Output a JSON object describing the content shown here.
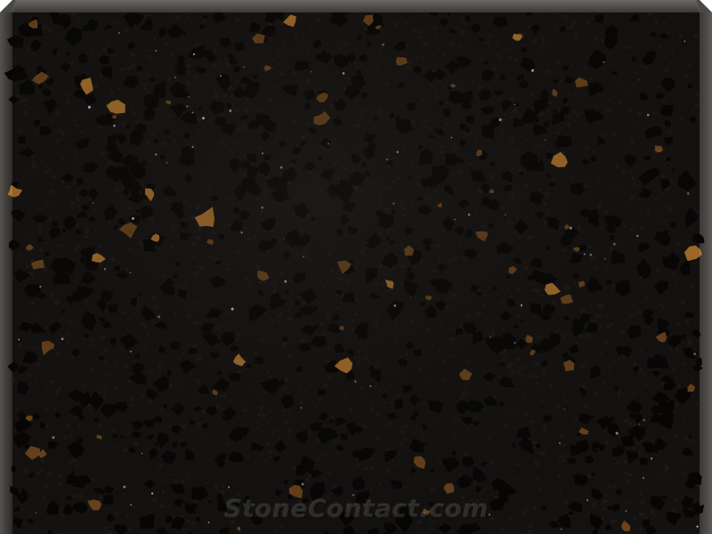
{
  "image": {
    "subject": "Black quartz stone slab with golden speckles",
    "colors": {
      "background": "#ffffff",
      "slab_base": "#141210",
      "slab_edge_light": "#5a5855",
      "slab_edge_dark": "#2a2826",
      "chip_dark": "#070605",
      "chip_mid": "#1e1a17",
      "chip_gold": "#b5782f",
      "chip_gold_dark": "#7a4e1e",
      "sparkle": "#cfd3d6"
    }
  },
  "watermark": {
    "text": "StoneContact.com"
  }
}
